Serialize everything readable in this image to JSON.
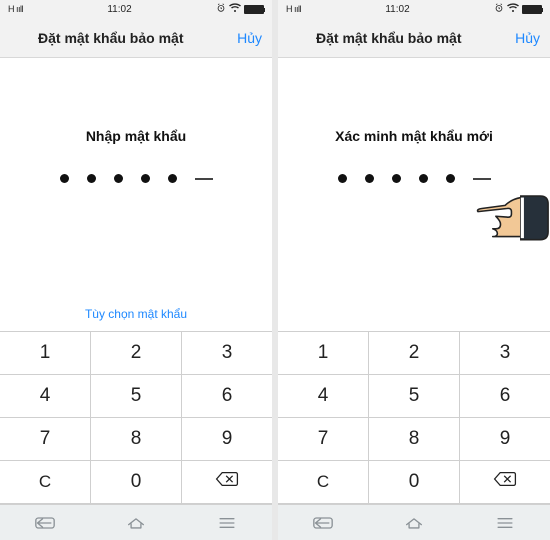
{
  "left": {
    "status": {
      "signal": "H ııll",
      "time": "11:02"
    },
    "header": {
      "title": "Đặt mật khẩu bảo mật",
      "cancel": "Hủy"
    },
    "prompt": "Nhập mật khẩu",
    "options": "Tùy chọn mật khẩu",
    "keypad": {
      "r1": [
        "1",
        "2",
        "3"
      ],
      "r2": [
        "4",
        "5",
        "6"
      ],
      "r3": [
        "7",
        "8",
        "9"
      ],
      "r4": [
        "C",
        "0",
        "⌫"
      ]
    }
  },
  "right": {
    "status": {
      "signal": "H ııll",
      "time": "11:02"
    },
    "header": {
      "title": "Đặt mật khẩu bảo mật",
      "cancel": "Hủy"
    },
    "prompt": "Xác minh mật khẩu mới",
    "keypad": {
      "r1": [
        "1",
        "2",
        "3"
      ],
      "r2": [
        "4",
        "5",
        "6"
      ],
      "r3": [
        "7",
        "8",
        "9"
      ],
      "r4": [
        "C",
        "0",
        "⌫"
      ]
    }
  },
  "password": {
    "filled": 5,
    "total": 6
  }
}
